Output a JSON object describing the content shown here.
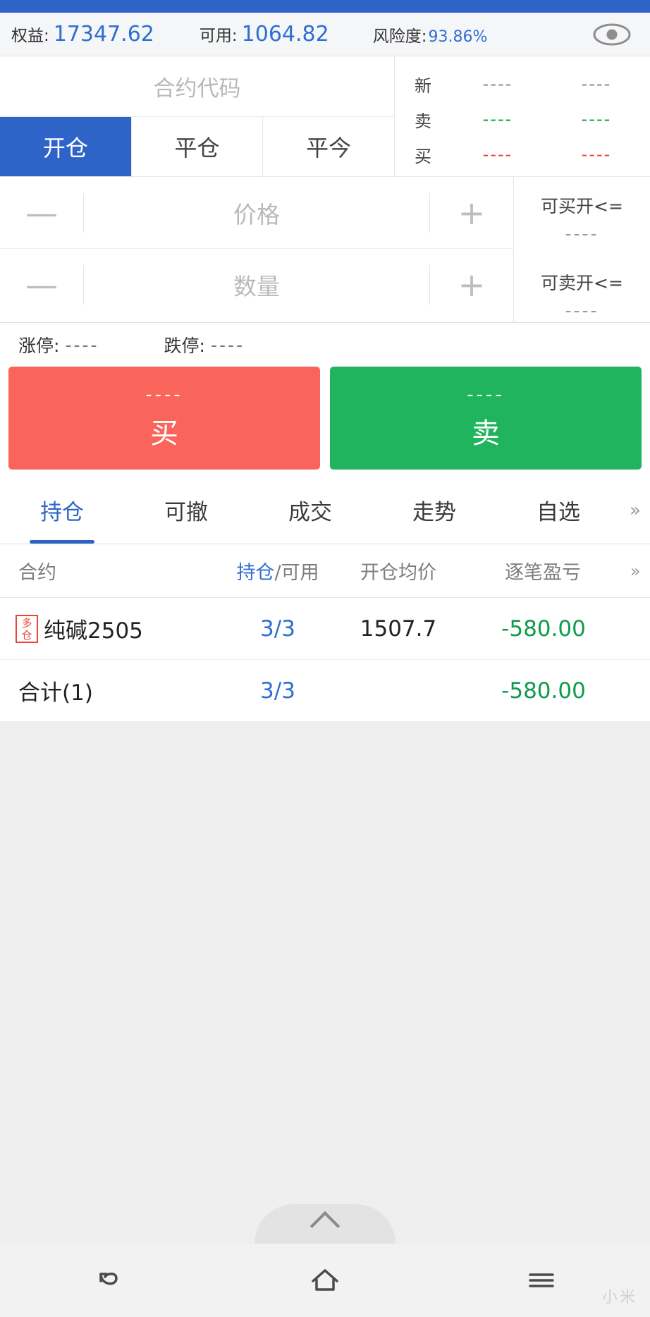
{
  "account": {
    "equity_label": "权益:",
    "equity_value": "17347.62",
    "available_label": "可用:",
    "available_value": "1064.82",
    "risk_label": "风险度:",
    "risk_value": "93.86%",
    "eye_icon": "eye-icon"
  },
  "order": {
    "contract_placeholder": "合约代码",
    "tabs": [
      {
        "label": "开仓",
        "active": true
      },
      {
        "label": "平仓",
        "active": false
      },
      {
        "label": "平今",
        "active": false
      }
    ],
    "quote_rows": [
      {
        "tag": "新",
        "v1": "----",
        "v2": "----",
        "color": "gray"
      },
      {
        "tag": "卖",
        "v1": "----",
        "v2": "----",
        "color": "green"
      },
      {
        "tag": "买",
        "v1": "----",
        "v2": "----",
        "color": "red"
      }
    ],
    "price_minus": "—",
    "price_placeholder": "价格",
    "price_plus": "+",
    "qty_minus": "—",
    "qty_placeholder": "数量",
    "qty_plus": "+",
    "buy_open_label": "可买开<=",
    "buy_open_value": "----",
    "sell_open_label": "可卖开<=",
    "sell_open_value": "----",
    "limit_up_label": "涨停:",
    "limit_up_value": "----",
    "limit_down_label": "跌停:",
    "limit_down_value": "----",
    "buy_dash": "----",
    "buy_word": "买",
    "sell_dash": "----",
    "sell_word": "卖",
    "buy_color": "#f9655b",
    "sell_color": "#21b45e"
  },
  "main_tabs": {
    "items": [
      {
        "label": "持仓",
        "active": true
      },
      {
        "label": "可撤",
        "active": false
      },
      {
        "label": "成交",
        "active": false
      },
      {
        "label": "走势",
        "active": false
      },
      {
        "label": "自选",
        "active": false
      }
    ],
    "more": "»"
  },
  "positions": {
    "headers": {
      "contract": "合约",
      "position_hl": "持仓",
      "position_rest": "/可用",
      "avg_price": "开仓均价",
      "pl": "逐笔盈亏",
      "more": "»"
    },
    "rows": [
      {
        "badge": "多仓",
        "name": "纯碱2505",
        "position": "3/3",
        "avg_price": "1507.7",
        "pl": "-580.00"
      }
    ],
    "total": {
      "name": "合计(1)",
      "position": "3/3",
      "avg_price": "",
      "pl": "-580.00"
    }
  },
  "navbar": {
    "back_icon": "back-icon",
    "home_icon": "home-icon",
    "menu_icon": "menu-icon",
    "watermark": "小米"
  }
}
